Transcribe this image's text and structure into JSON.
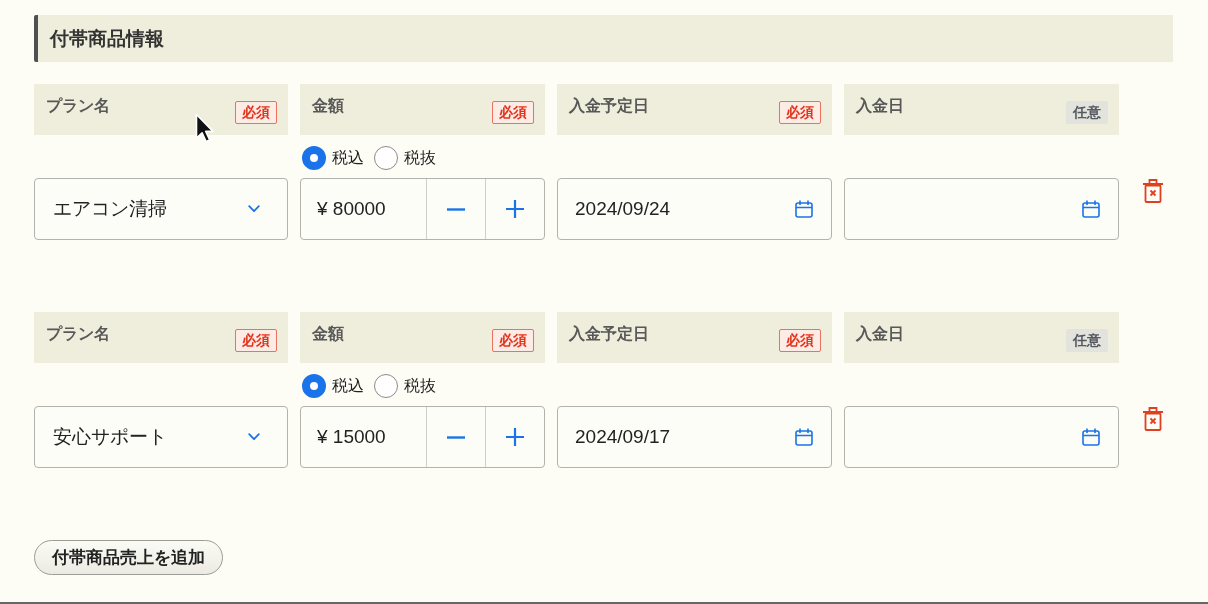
{
  "section": {
    "title": "付帯商品情報"
  },
  "items": [
    {
      "fields": [
        {
          "kind": "select",
          "label": "プラン名",
          "badge": "必須",
          "required": true,
          "value": "エアコン清掃"
        },
        {
          "kind": "amount",
          "label": "金額",
          "badge": "必須",
          "required": true,
          "tax_options": [
            {
              "label": "税込",
              "selected": true
            },
            {
              "label": "税抜",
              "selected": false
            }
          ],
          "value": "¥ 80000"
        },
        {
          "kind": "date",
          "label": "入金予定日",
          "badge": "必須",
          "required": true,
          "value": "2024/09/24"
        },
        {
          "kind": "date",
          "label": "入金日",
          "badge": "任意",
          "required": false
        }
      ]
    },
    {
      "fields": [
        {
          "kind": "select",
          "label": "プラン名",
          "badge": "必須",
          "required": true,
          "value": "安心サポート"
        },
        {
          "kind": "amount",
          "label": "金額",
          "badge": "必須",
          "required": true,
          "tax_options": [
            {
              "label": "税込",
              "selected": true
            },
            {
              "label": "税抜",
              "selected": false
            }
          ],
          "value": "¥ 15000"
        },
        {
          "kind": "date",
          "label": "入金予定日",
          "badge": "必須",
          "required": true,
          "value": "2024/09/17"
        },
        {
          "kind": "date",
          "label": "入金日",
          "badge": "任意",
          "required": false
        }
      ]
    }
  ],
  "add_button": "付帯商品売上を追加"
}
